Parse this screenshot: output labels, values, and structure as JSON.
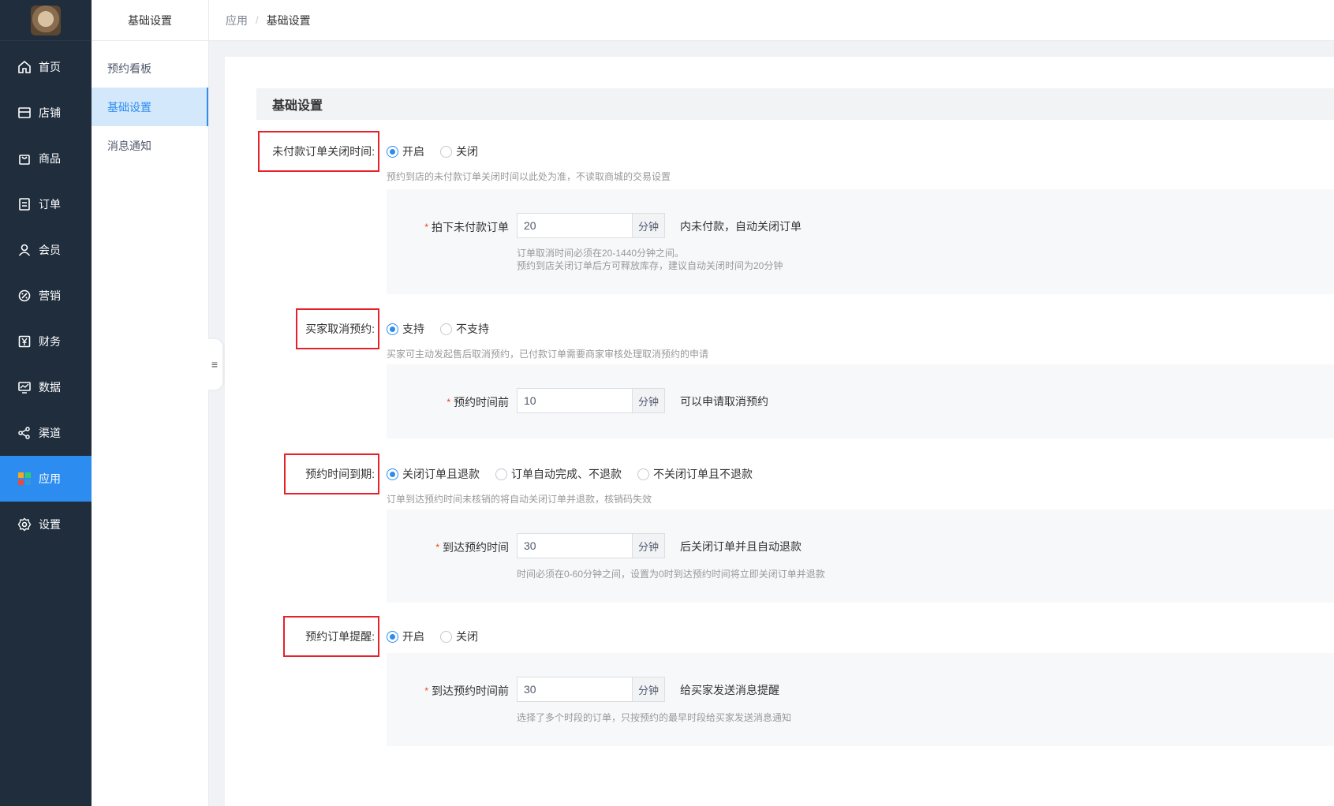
{
  "sidebar": {
    "items": [
      {
        "label": "首页",
        "icon": "home-icon"
      },
      {
        "label": "店铺",
        "icon": "store-icon"
      },
      {
        "label": "商品",
        "icon": "bag-icon"
      },
      {
        "label": "订单",
        "icon": "order-icon"
      },
      {
        "label": "会员",
        "icon": "user-icon"
      },
      {
        "label": "营销",
        "icon": "marketing-icon"
      },
      {
        "label": "财务",
        "icon": "yen-icon"
      },
      {
        "label": "数据",
        "icon": "chart-icon"
      },
      {
        "label": "渠道",
        "icon": "share-icon"
      },
      {
        "label": "应用",
        "icon": "apps-icon"
      },
      {
        "label": "设置",
        "icon": "gear-icon"
      }
    ],
    "active_index": 9
  },
  "subnav": {
    "title": "基础设置",
    "items": [
      {
        "label": "预约看板"
      },
      {
        "label": "基础设置"
      },
      {
        "label": "消息通知"
      }
    ]
  },
  "breadcrumb": {
    "first": "应用",
    "separator": "/",
    "current": "基础设置"
  },
  "collapse_icon": "≡",
  "section_title": "基础设置",
  "settings": [
    {
      "label": "未付款订单关闭时间:",
      "options": [
        "开启",
        "关闭"
      ],
      "hint": "预约到店的未付款订单关闭时间以此处为准，不读取商城的交易设置",
      "field_label": "拍下未付款订单",
      "value": "20",
      "unit": "分钟",
      "after": "内未付款，自动关闭订单",
      "panel_hint_1": "订单取消时间必须在20-1440分钟之间。",
      "panel_hint_2": "预约到店关闭订单后方可释放库存，建议自动关闭时间为20分钟"
    },
    {
      "label": "买家取消预约:",
      "options": [
        "支持",
        "不支持"
      ],
      "hint": "买家可主动发起售后取消预约，已付款订单需要商家审核处理取消预约的申请",
      "field_label": "预约时间前",
      "value": "10",
      "unit": "分钟",
      "after": "可以申请取消预约"
    },
    {
      "label": "预约时间到期:",
      "options": [
        "关闭订单且退款",
        "订单自动完成、不退款",
        "不关闭订单且不退款"
      ],
      "hint": "订单到达预约时间未核销的将自动关闭订单并退款，核销码失效",
      "field_label": "到达预约时间",
      "value": "30",
      "unit": "分钟",
      "after": "后关闭订单并且自动退款",
      "panel_hint_1": "时间必须在0-60分钟之间，设置为0时到达预约时间将立即关闭订单并退款"
    },
    {
      "label": "预约订单提醒:",
      "options": [
        "开启",
        "关闭"
      ],
      "field_label": "到达预约时间前",
      "value": "30",
      "unit": "分钟",
      "after": "给买家发送消息提醒",
      "panel_hint_1": "选择了多个时段的订单，只按预约的最早时段给买家发送消息通知"
    }
  ],
  "colors": {
    "accent": "#2d8cf0",
    "sidebar_bg": "#1f2d3d",
    "highlight_border": "#e6212a"
  }
}
